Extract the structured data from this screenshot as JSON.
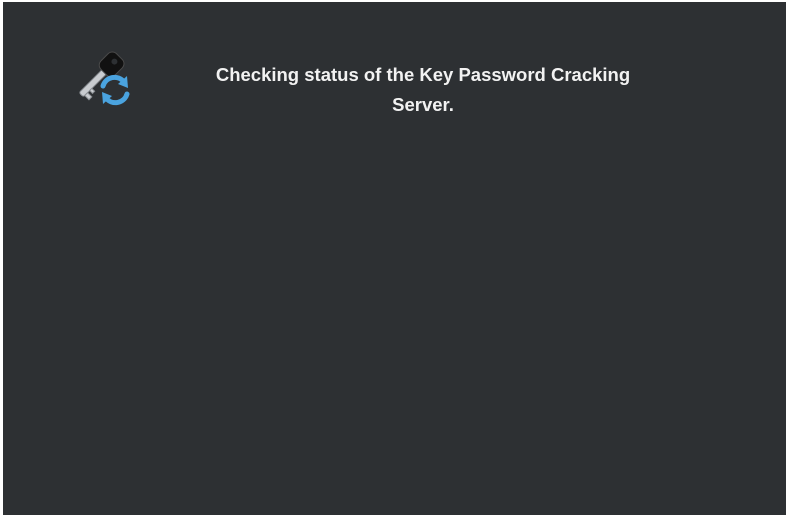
{
  "screen": {
    "background_color": "#2d3033",
    "status_icon": "key-refresh-icon",
    "status_message": "Checking status of the Key Password Cracking\nServer.",
    "text_color": "#f2f2f2"
  }
}
